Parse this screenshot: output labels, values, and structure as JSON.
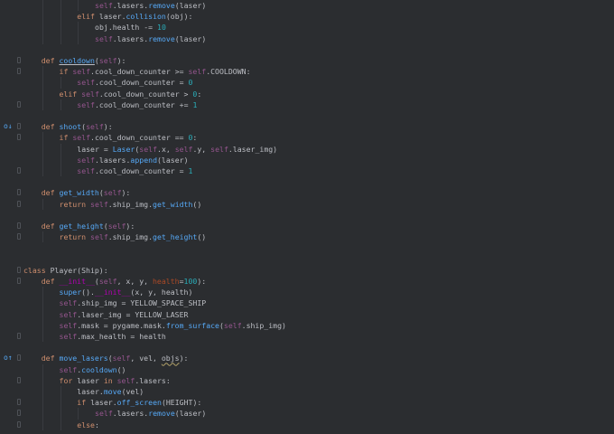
{
  "editor": {
    "language": "python",
    "lines": [
      {
        "indent": 4,
        "tokens": [
          [
            "slf",
            "self"
          ],
          [
            "p",
            ".lasers."
          ],
          [
            "call",
            "remove"
          ],
          [
            "p",
            "(laser)"
          ]
        ]
      },
      {
        "indent": 3,
        "tokens": [
          [
            "kw",
            "elif "
          ],
          [
            "p",
            "laser."
          ],
          [
            "call",
            "collision"
          ],
          [
            "p",
            "(obj):"
          ]
        ]
      },
      {
        "indent": 4,
        "tokens": [
          [
            "p",
            "obj.health -= "
          ],
          [
            "num",
            "10"
          ]
        ]
      },
      {
        "indent": 4,
        "tokens": [
          [
            "slf",
            "self"
          ],
          [
            "p",
            ".lasers."
          ],
          [
            "call",
            "remove"
          ],
          [
            "p",
            "(laser)"
          ]
        ]
      },
      {
        "indent": 0,
        "tokens": []
      },
      {
        "indent": 1,
        "fold": true,
        "tokens": [
          [
            "kw",
            "def "
          ],
          [
            "fnu",
            "cooldown"
          ],
          [
            "p",
            "("
          ],
          [
            "slf",
            "self"
          ],
          [
            "p",
            "):"
          ]
        ]
      },
      {
        "indent": 2,
        "fold": true,
        "tokens": [
          [
            "kw",
            "if "
          ],
          [
            "slf",
            "self"
          ],
          [
            "p",
            ".cool_down_counter >= "
          ],
          [
            "slf",
            "self"
          ],
          [
            "p",
            ".COOLDOWN:"
          ]
        ]
      },
      {
        "indent": 3,
        "tokens": [
          [
            "slf",
            "self"
          ],
          [
            "p",
            ".cool_down_counter = "
          ],
          [
            "num",
            "0"
          ]
        ]
      },
      {
        "indent": 2,
        "tokens": [
          [
            "kw",
            "elif "
          ],
          [
            "slf",
            "self"
          ],
          [
            "p",
            ".cool_down_counter > "
          ],
          [
            "num",
            "0"
          ],
          [
            "p",
            ":"
          ]
        ]
      },
      {
        "indent": 3,
        "fold": true,
        "tokens": [
          [
            "slf",
            "self"
          ],
          [
            "p",
            ".cool_down_counter += "
          ],
          [
            "num",
            "1"
          ]
        ]
      },
      {
        "indent": 0,
        "tokens": []
      },
      {
        "indent": 1,
        "fold": true,
        "marker": "o↓",
        "tokens": [
          [
            "kw",
            "def "
          ],
          [
            "fn",
            "shoot"
          ],
          [
            "p",
            "("
          ],
          [
            "slf",
            "self"
          ],
          [
            "p",
            "):"
          ]
        ]
      },
      {
        "indent": 2,
        "fold": true,
        "tokens": [
          [
            "kw",
            "if "
          ],
          [
            "slf",
            "self"
          ],
          [
            "p",
            ".cool_down_counter == "
          ],
          [
            "num",
            "0"
          ],
          [
            "p",
            ":"
          ]
        ]
      },
      {
        "indent": 3,
        "tokens": [
          [
            "p",
            "laser = "
          ],
          [
            "call",
            "Laser"
          ],
          [
            "p",
            "("
          ],
          [
            "slf",
            "self"
          ],
          [
            "p",
            ".x, "
          ],
          [
            "slf",
            "self"
          ],
          [
            "p",
            ".y, "
          ],
          [
            "slf",
            "self"
          ],
          [
            "p",
            ".laser_img)"
          ]
        ]
      },
      {
        "indent": 3,
        "tokens": [
          [
            "slf",
            "self"
          ],
          [
            "p",
            ".lasers."
          ],
          [
            "call",
            "append"
          ],
          [
            "p",
            "(laser)"
          ]
        ]
      },
      {
        "indent": 3,
        "fold": true,
        "tokens": [
          [
            "slf",
            "self"
          ],
          [
            "p",
            ".cool_down_counter = "
          ],
          [
            "num",
            "1"
          ]
        ]
      },
      {
        "indent": 0,
        "tokens": []
      },
      {
        "indent": 1,
        "fold": true,
        "tokens": [
          [
            "kw",
            "def "
          ],
          [
            "fn",
            "get_width"
          ],
          [
            "p",
            "("
          ],
          [
            "slf",
            "self"
          ],
          [
            "p",
            "):"
          ]
        ]
      },
      {
        "indent": 2,
        "fold": true,
        "tokens": [
          [
            "kw",
            "return "
          ],
          [
            "slf",
            "self"
          ],
          [
            "p",
            ".ship_img."
          ],
          [
            "call",
            "get_width"
          ],
          [
            "p",
            "()"
          ]
        ]
      },
      {
        "indent": 0,
        "tokens": []
      },
      {
        "indent": 1,
        "fold": true,
        "tokens": [
          [
            "kw",
            "def "
          ],
          [
            "fn",
            "get_height"
          ],
          [
            "p",
            "("
          ],
          [
            "slf",
            "self"
          ],
          [
            "p",
            "):"
          ]
        ]
      },
      {
        "indent": 2,
        "fold": true,
        "tokens": [
          [
            "kw",
            "return "
          ],
          [
            "slf",
            "self"
          ],
          [
            "p",
            ".ship_img."
          ],
          [
            "call",
            "get_height"
          ],
          [
            "p",
            "()"
          ]
        ]
      },
      {
        "indent": 0,
        "tokens": []
      },
      {
        "indent": 0,
        "tokens": []
      },
      {
        "indent": 0,
        "fold": true,
        "tokens": [
          [
            "kw",
            "class "
          ],
          [
            "cls",
            "Player"
          ],
          [
            "p",
            "(Ship):"
          ]
        ]
      },
      {
        "indent": 1,
        "fold": true,
        "tokens": [
          [
            "kw",
            "def "
          ],
          [
            "dunder",
            "__init__"
          ],
          [
            "p",
            "("
          ],
          [
            "slf",
            "self"
          ],
          [
            "p",
            ", x, y, "
          ],
          [
            "prm",
            "health"
          ],
          [
            "p",
            "="
          ],
          [
            "num",
            "100"
          ],
          [
            "p",
            "):"
          ]
        ]
      },
      {
        "indent": 2,
        "tokens": [
          [
            "call",
            "super"
          ],
          [
            "p",
            "()."
          ],
          [
            "dunder",
            "__init__"
          ],
          [
            "p",
            "(x, y, health)"
          ]
        ]
      },
      {
        "indent": 2,
        "tokens": [
          [
            "slf",
            "self"
          ],
          [
            "p",
            ".ship_img = YELLOW_SPACE_SHIP"
          ]
        ]
      },
      {
        "indent": 2,
        "tokens": [
          [
            "slf",
            "self"
          ],
          [
            "p",
            ".laser_img = YELLOW_LASER"
          ]
        ]
      },
      {
        "indent": 2,
        "tokens": [
          [
            "slf",
            "self"
          ],
          [
            "p",
            ".mask = pygame.mask."
          ],
          [
            "call",
            "from_surface"
          ],
          [
            "p",
            "("
          ],
          [
            "slf",
            "self"
          ],
          [
            "p",
            ".ship_img)"
          ]
        ]
      },
      {
        "indent": 2,
        "fold": true,
        "tokens": [
          [
            "slf",
            "self"
          ],
          [
            "p",
            ".max_health = health"
          ]
        ]
      },
      {
        "indent": 0,
        "tokens": []
      },
      {
        "indent": 1,
        "fold": true,
        "marker": "o↑",
        "tokens": [
          [
            "kw",
            "def "
          ],
          [
            "fn",
            "move_lasers"
          ],
          [
            "p",
            "("
          ],
          [
            "slf",
            "self"
          ],
          [
            "p",
            ", vel, "
          ],
          [
            "err",
            "objs"
          ],
          [
            "p",
            "):"
          ]
        ]
      },
      {
        "indent": 2,
        "tokens": [
          [
            "slf",
            "self"
          ],
          [
            "p",
            "."
          ],
          [
            "call",
            "cooldown"
          ],
          [
            "p",
            "()"
          ]
        ]
      },
      {
        "indent": 2,
        "fold": true,
        "tokens": [
          [
            "kw",
            "for "
          ],
          [
            "p",
            "laser "
          ],
          [
            "kw",
            "in "
          ],
          [
            "slf",
            "self"
          ],
          [
            "p",
            ".lasers:"
          ]
        ]
      },
      {
        "indent": 3,
        "tokens": [
          [
            "p",
            "laser."
          ],
          [
            "call",
            "move"
          ],
          [
            "p",
            "(vel)"
          ]
        ]
      },
      {
        "indent": 3,
        "fold": true,
        "tokens": [
          [
            "kw",
            "if "
          ],
          [
            "p",
            "laser."
          ],
          [
            "call",
            "off_screen"
          ],
          [
            "p",
            "(HEIGHT):"
          ]
        ]
      },
      {
        "indent": 4,
        "fold": true,
        "tokens": [
          [
            "slf",
            "self"
          ],
          [
            "p",
            ".lasers."
          ],
          [
            "call",
            "remove"
          ],
          [
            "p",
            "(laser)"
          ]
        ]
      },
      {
        "indent": 3,
        "fold": true,
        "tokens": [
          [
            "kw",
            "else"
          ],
          [
            "p",
            ":"
          ]
        ]
      }
    ]
  }
}
